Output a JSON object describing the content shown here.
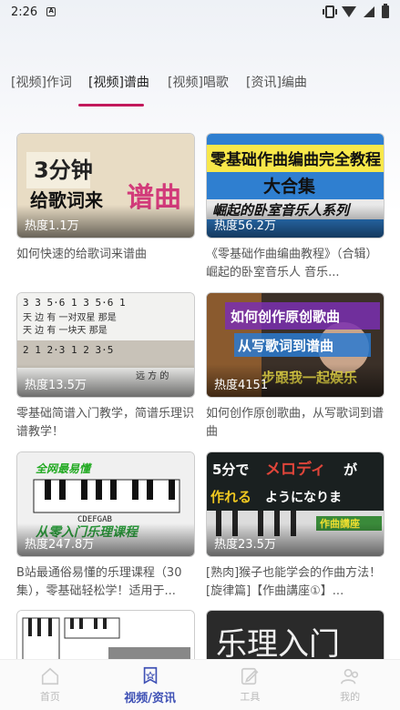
{
  "status": {
    "time": "2:26",
    "notif": "A"
  },
  "tabs": [
    {
      "label": "[视频]作词"
    },
    {
      "label": "[视频]谱曲"
    },
    {
      "label": "[视频]唱歌"
    },
    {
      "label": "[资讯]编曲"
    }
  ],
  "videos": [
    {
      "heat": "热度1.1万",
      "caption": "如何快速的给歌词来谱曲",
      "thumb_text": "3分钟 给歌词来谱曲"
    },
    {
      "heat": "热度56.2万",
      "caption": "《零基础作曲编曲教程》（合辑）崛起的卧室音乐人 音乐...",
      "thumb_text": "零基础作曲编曲完全教程 大合集 崛起的卧室音乐人系列"
    },
    {
      "heat": "热度13.5万",
      "caption": "零基础简谱入门教学，简谱乐理识谱教学！",
      "thumb_text": "天 边 有 一对双星 那是"
    },
    {
      "heat": "热度4151",
      "caption": "如何创作原创歌曲，从写歌词到谱曲",
      "thumb_text": "如何创作原创歌曲 从写歌词到谱曲 步跟我一起娱乐"
    },
    {
      "heat": "热度247.8万",
      "caption": "B站最通俗易懂的乐理课程（30集），零基础轻松学！适用于...",
      "thumb_text": "全网最易懂 CDEFGAB 从零入门乐理课程"
    },
    {
      "heat": "热度23.5万",
      "caption": "[熟肉]猴子也能学会的作曲方法！[旋律篇]【作曲講座①】...",
      "thumb_text": "5分でメロディが作れるようになりま 作曲講座"
    },
    {
      "heat": "",
      "caption": "",
      "thumb_text": ""
    },
    {
      "heat": "",
      "caption": "",
      "thumb_text": "乐理入门"
    }
  ],
  "nav": [
    {
      "label": "首页",
      "icon": "home-icon"
    },
    {
      "label": "视频/资讯",
      "icon": "video-bookmark-icon"
    },
    {
      "label": "工具",
      "icon": "edit-icon"
    },
    {
      "label": "我的",
      "icon": "user-icon"
    }
  ],
  "colors": {
    "accent": "#c2185b",
    "nav_active": "#3f51b5"
  }
}
